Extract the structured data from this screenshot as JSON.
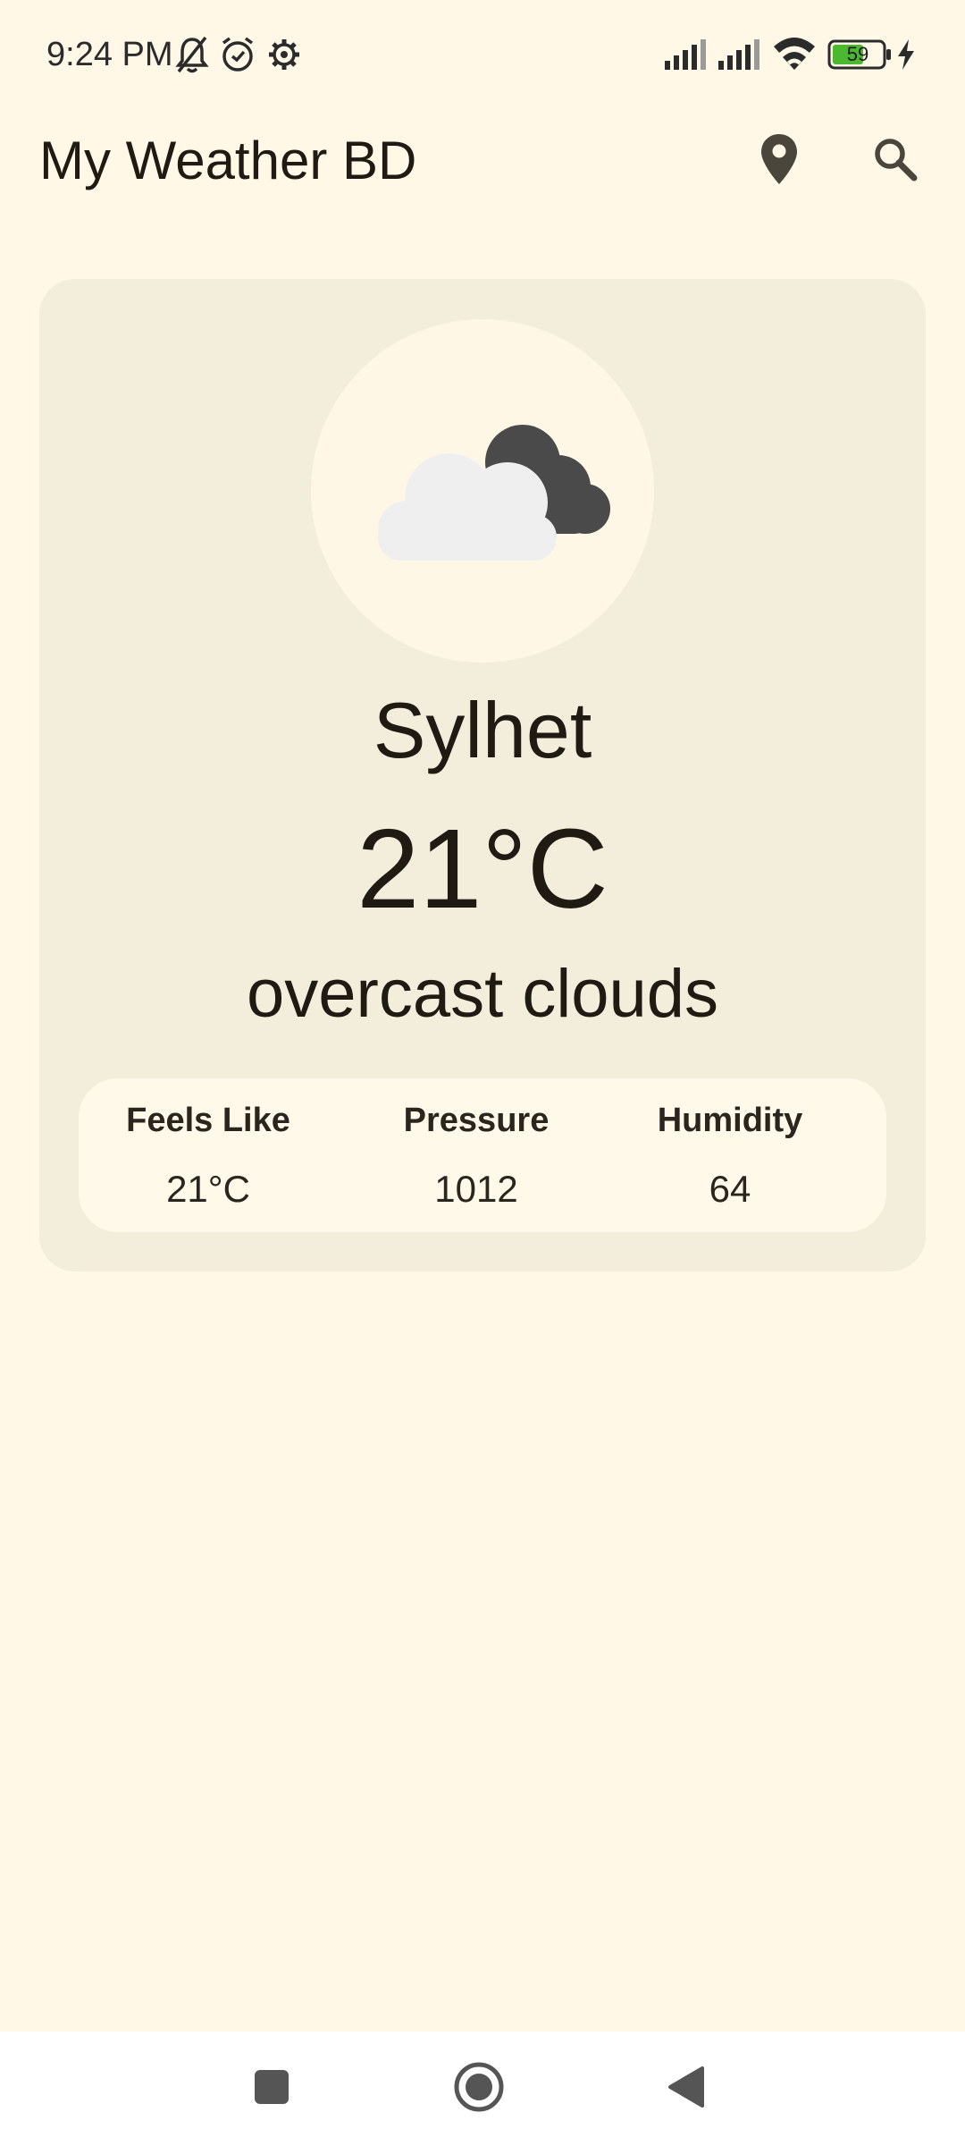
{
  "status_bar": {
    "time": "9:24 PM",
    "battery_level": "59",
    "icons": [
      "notifications-off-icon",
      "alarm-icon",
      "settings-gear-icon",
      "signal-icon",
      "signal-icon",
      "wifi-icon",
      "battery-icon",
      "charging-bolt-icon"
    ]
  },
  "app_bar": {
    "title": "My Weather BD",
    "actions": [
      "location-pin-icon",
      "search-icon"
    ]
  },
  "weather": {
    "icon": "overcast-clouds-icon",
    "city": "Sylhet",
    "temperature": "21°C",
    "condition": "overcast clouds",
    "stats": [
      {
        "label": "Feels Like",
        "value": "21°C"
      },
      {
        "label": "Pressure",
        "value": "1012"
      },
      {
        "label": "Humidity",
        "value": "64"
      }
    ]
  },
  "nav_bar": {
    "buttons": [
      "recents-square-icon",
      "home-circle-icon",
      "back-triangle-icon"
    ]
  },
  "colors": {
    "background": "#FFF8E7",
    "card": "#F3EDDC",
    "stats_panel": "#FFF9EA",
    "text": "#1F1B13",
    "icon": "#4A463C",
    "battery_fill": "#4CB82F"
  }
}
